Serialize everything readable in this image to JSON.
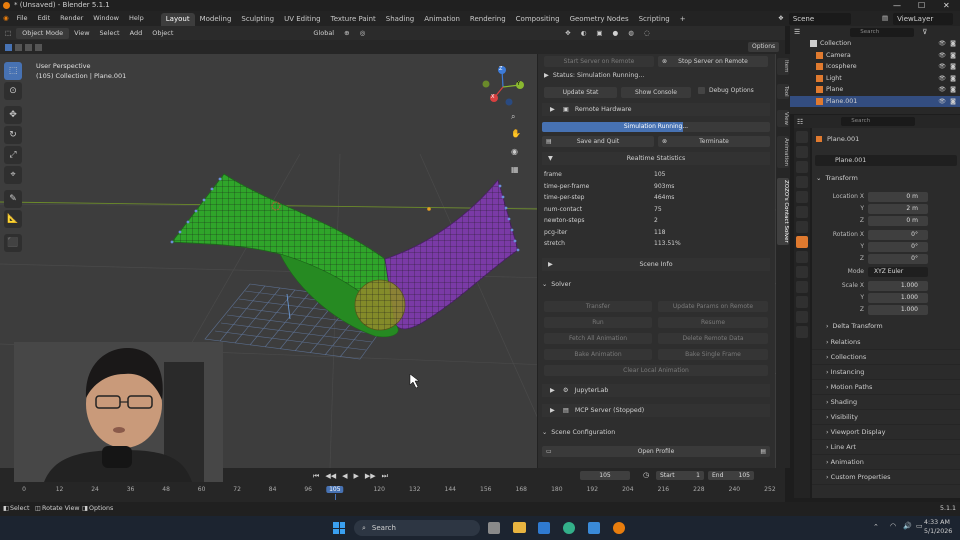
{
  "window": {
    "title": "* (Unsaved) - Blender 5.1.1",
    "min": "—",
    "max": "☐",
    "close": "✕"
  },
  "menu": [
    "File",
    "Edit",
    "Render",
    "Window",
    "Help"
  ],
  "workspaces": [
    "Layout",
    "Modeling",
    "Sculpting",
    "UV Editing",
    "Texture Paint",
    "Shading",
    "Animation",
    "Rendering",
    "Compositing",
    "Geometry Nodes",
    "Scripting"
  ],
  "active_workspace": "Layout",
  "scene": {
    "label": "Scene",
    "view_layer": "ViewLayer"
  },
  "viewport_header": {
    "mode": "Object Mode",
    "menus": [
      "View",
      "Select",
      "Add",
      "Object"
    ],
    "transform": "Global",
    "options": "Options"
  },
  "viewport_info": {
    "line1": "User Perspective",
    "line2": "(105) Collection | Plane.001"
  },
  "gizmo": {
    "x": "X",
    "y": "Y",
    "z": "Z"
  },
  "npanel": {
    "start_server": "Start Server on Remote",
    "stop_server": "Stop Server on Remote",
    "status": "Status: Simulation Running...",
    "update_stat": "Update Stat",
    "show_console": "Show Console",
    "debug_options": "Debug Options",
    "remote_hardware": "Remote Hardware",
    "progress_label": "Simulation Running...",
    "progress": 0.62,
    "save_and_quit": "Save and Quit",
    "terminate": "Terminate",
    "realtime_stats_title": "Realtime Statistics",
    "stats": [
      {
        "k": "frame",
        "v": "105"
      },
      {
        "k": "time-per-frame",
        "v": "903ms"
      },
      {
        "k": "time-per-step",
        "v": "464ms"
      },
      {
        "k": "num-contact",
        "v": "75"
      },
      {
        "k": "newton-steps",
        "v": "2"
      },
      {
        "k": "pcg-iter",
        "v": "118"
      },
      {
        "k": "stretch",
        "v": "113.51%"
      }
    ],
    "scene_info": "Scene Info",
    "solver": "Solver",
    "transfer": "Transfer",
    "update_params": "Update Params on Remote",
    "run": "Run",
    "resume": "Resume",
    "fetch_all": "Fetch All Animation",
    "delete_remote": "Delete Remote Data",
    "bake_animation": "Bake Animation",
    "bake_single": "Bake Single Frame",
    "clear_local": "Clear Local Animation",
    "jupyterlab": "JupyterLab",
    "mcp_server": "MCP Server (Stopped)",
    "scene_config": "Scene Configuration",
    "open_profile": "Open Profile"
  },
  "sidetabs": [
    "Item",
    "Tool",
    "View",
    "Animation",
    "ZOZO's Contact Solver"
  ],
  "outliner": {
    "search_placeholder": "Search",
    "items": [
      {
        "name": "Collection",
        "color": "#cccccc"
      },
      {
        "name": "Camera",
        "color": "#e07a2f"
      },
      {
        "name": "Icosphere",
        "color": "#e07a2f"
      },
      {
        "name": "Light",
        "color": "#e07a2f"
      },
      {
        "name": "Plane",
        "color": "#e07a2f"
      },
      {
        "name": "Plane.001",
        "color": "#e07a2f"
      }
    ]
  },
  "properties": {
    "search_placeholder": "Search",
    "object": "Plane.001",
    "data": "Plane.001",
    "transform": "Transform",
    "location": {
      "label": "Location X",
      "x": "0 m",
      "y": "2 m",
      "z": "0 m"
    },
    "rotation": {
      "label": "Rotation X",
      "x": "0°",
      "y": "0°",
      "z": "0°"
    },
    "mode_label": "Mode",
    "mode": "XYZ Euler",
    "scale": {
      "label": "Scale X",
      "x": "1.000",
      "y": "1.000",
      "z": "1.000"
    },
    "y": "Y",
    "z": "Z",
    "delta": "Delta Transform",
    "sections": [
      "Relations",
      "Collections",
      "Instancing",
      "Motion Paths",
      "Shading",
      "Visibility",
      "Viewport Display",
      "Line Art",
      "Animation",
      "Custom Properties"
    ]
  },
  "timeline": {
    "current": "105",
    "start_label": "Start",
    "start": "1",
    "end_label": "End",
    "end": "105",
    "ticks": [
      "0",
      "12",
      "24",
      "36",
      "48",
      "60",
      "72",
      "84",
      "96",
      "105",
      "120",
      "132",
      "144",
      "156",
      "168",
      "180",
      "192",
      "204",
      "216",
      "228",
      "240",
      "252"
    ]
  },
  "statusbar": {
    "select": "Select",
    "rotate": "Rotate View",
    "options": "Options",
    "version": "5.1.1"
  },
  "taskbar": {
    "search": "Search",
    "time": "4:33 AM",
    "date": "5/1/2026"
  },
  "colors": {
    "accent": "#4772b3",
    "green": "#2fa52a",
    "purple": "#7a3aa6",
    "sphere": "#8e8a2a"
  }
}
